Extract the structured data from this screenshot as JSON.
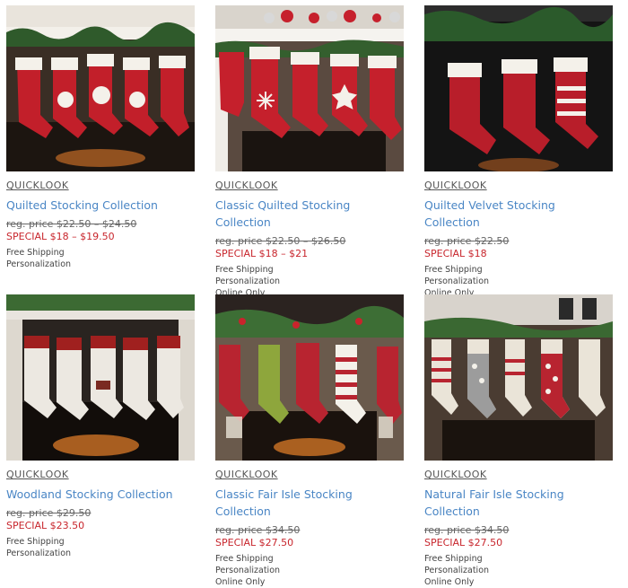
{
  "products": [
    {
      "quicklook": "QUICKLOOK",
      "title": "Quilted Stocking Collection",
      "reg_price": "reg. price $22.50 – $24.50",
      "special_price": "SPECIAL $18 – $19.50",
      "notes": [
        "Free Shipping",
        "Personalization"
      ]
    },
    {
      "quicklook": "QUICKLOOK",
      "title": "Classic Quilted Stocking Collection",
      "reg_price": "reg. price $22.50 – $26.50",
      "special_price": "SPECIAL $18 – $21",
      "notes": [
        "Free Shipping",
        "Personalization",
        "Online Only"
      ]
    },
    {
      "quicklook": "QUICKLOOK",
      "title": "Quilted Velvet Stocking Collection",
      "reg_price": "reg. price $22.50",
      "special_price": "SPECIAL $18",
      "notes": [
        "Free Shipping",
        "Personalization",
        "Online Only"
      ]
    },
    {
      "quicklook": "QUICKLOOK",
      "title": "Woodland Stocking Collection",
      "reg_price": "reg. price $29.50",
      "special_price": "SPECIAL $23.50",
      "notes": [
        "Free Shipping",
        "Personalization"
      ]
    },
    {
      "quicklook": "QUICKLOOK",
      "title": "Classic Fair Isle Stocking Collection",
      "reg_price": "reg. price $34.50",
      "special_price": "SPECIAL $27.50",
      "notes": [
        "Free Shipping",
        "Personalization",
        "Online Only"
      ]
    },
    {
      "quicklook": "QUICKLOOK",
      "title": "Natural Fair Isle Stocking Collection",
      "reg_price": "reg. price $34.50",
      "special_price": "SPECIAL $27.50",
      "notes": [
        "Free Shipping",
        "Personalization",
        "Online Only"
      ]
    }
  ],
  "colors": {
    "title_link": "#4a86c5",
    "special_price": "#c8262d",
    "stocking_red": "#b5202b"
  }
}
